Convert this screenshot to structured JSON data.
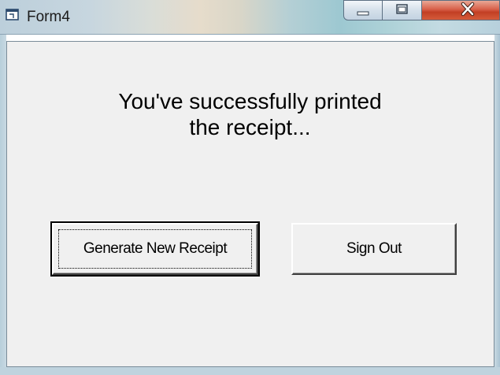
{
  "window": {
    "title": "Form4",
    "controls": {
      "minimize": "minimize",
      "maximize": "maximize",
      "close": "close"
    }
  },
  "message": {
    "line1": "You've successfully printed",
    "line2": "the receipt..."
  },
  "buttons": {
    "generate": "Generate New Receipt",
    "sign_out": "Sign Out"
  },
  "icons": {
    "app": "form-window-icon",
    "minimize": "minimize-icon",
    "maximize": "maximize-icon",
    "close": "close-icon"
  },
  "colors": {
    "client_bg": "#f0f0f0",
    "close_button": "#c94a30"
  }
}
